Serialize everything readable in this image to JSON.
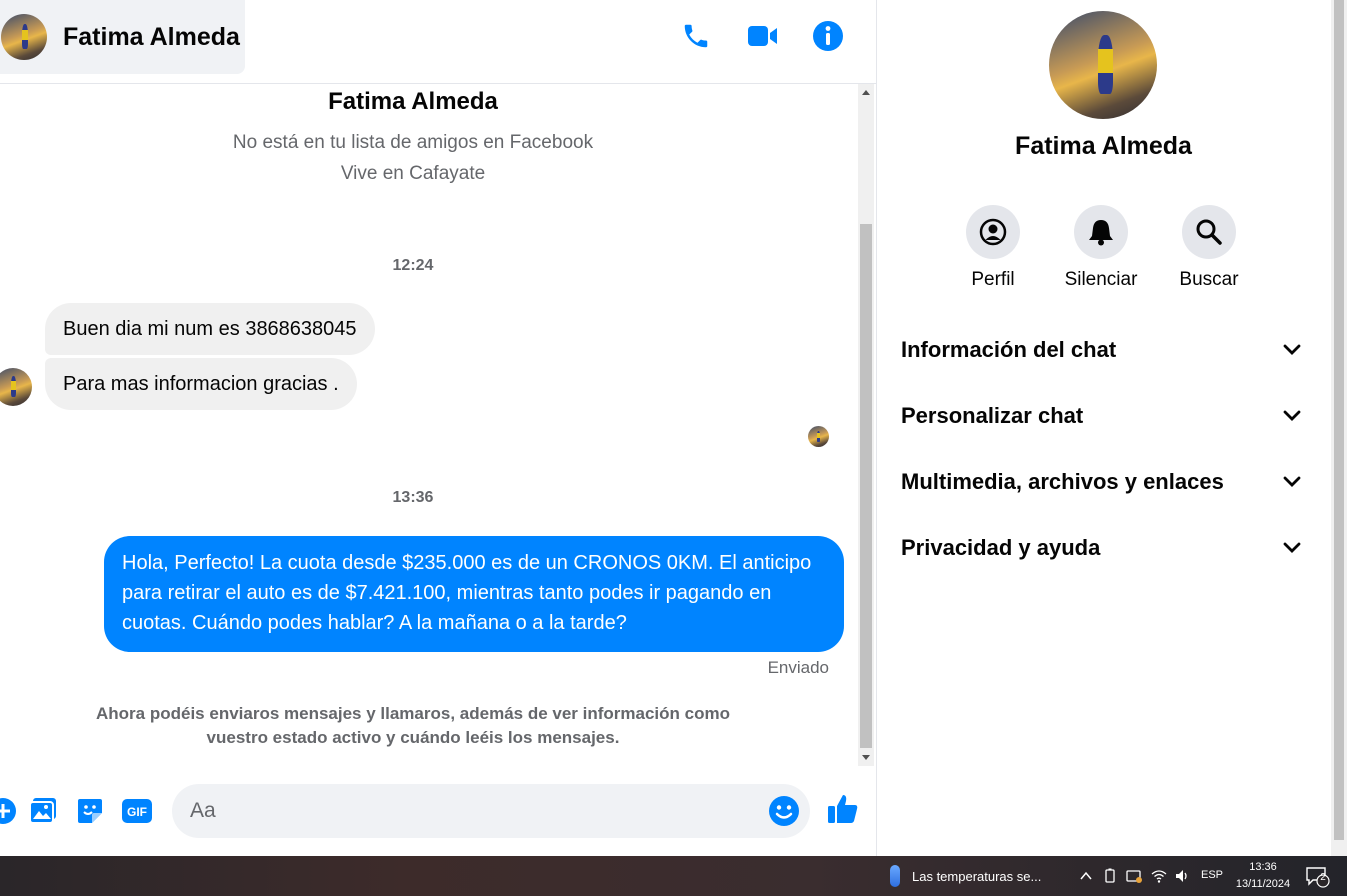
{
  "contact": {
    "name": "Fatima Almeda",
    "not_friends": "No está en tu lista de amigos en Facebook",
    "location": "Vive en Cafayate"
  },
  "header_icons": [
    "phone-icon",
    "video-camera-icon",
    "info-icon"
  ],
  "conversation": {
    "time1": "12:24",
    "incoming": [
      "Buen dia mi num es 3868638045",
      "Para mas informacion gracias ."
    ],
    "time2": "13:36",
    "outgoing": "Hola, Perfecto! La cuota desde $235.000 es de un CRONOS 0KM. El anticipo para retirar el auto es de $7.421.100, mientras tanto podes ir pagando en cuotas. Cuándo podes hablar? A la mañana o a la tarde?",
    "status": "Enviado",
    "notice": "Ahora podéis enviaros mensajes y llamaros, además de ver información como vuestro estado activo y cuándo leéis los mensajes."
  },
  "composer": {
    "placeholder": "Aa",
    "icons": [
      "plus-icon",
      "image-icon",
      "sticker-icon",
      "gif-icon",
      "emoji-icon",
      "like-icon"
    ],
    "gif_label": "GIF"
  },
  "info_panel": {
    "name": "Fatima Almeda",
    "actions": [
      {
        "label": "Perfil",
        "icon": "profile-icon"
      },
      {
        "label": "Silenciar",
        "icon": "bell-icon"
      },
      {
        "label": "Buscar",
        "icon": "search-icon"
      }
    ],
    "sections": [
      "Información del chat",
      "Personalizar chat",
      "Multimedia, archivos y enlaces",
      "Privacidad y ayuda"
    ]
  },
  "taskbar": {
    "weather": "Las temperaturas se...",
    "lang": "ESP",
    "time": "13:36",
    "date": "13/11/2024",
    "notifications": "2"
  },
  "colors": {
    "accent": "#0084ff",
    "incoming_bubble": "#f0f0f0",
    "secondary_text": "#65676b"
  }
}
